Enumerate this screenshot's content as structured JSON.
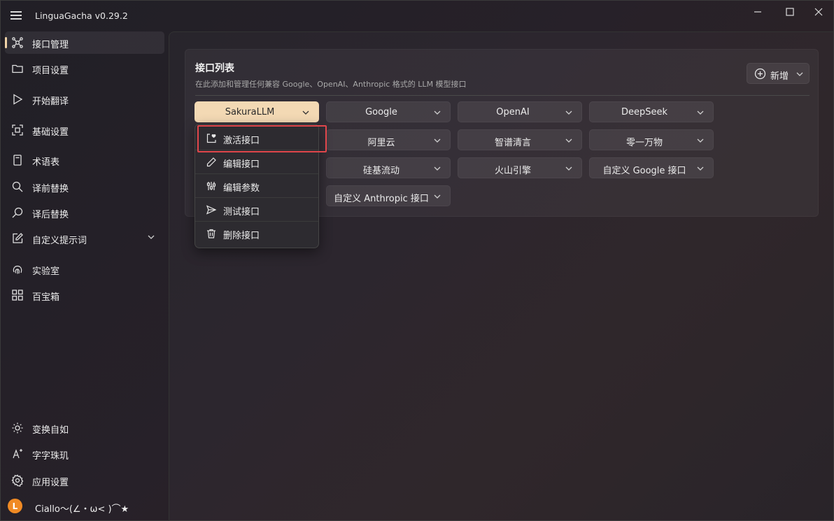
{
  "window": {
    "title": "LinguaGacha v0.29.2"
  },
  "sidebar": {
    "items": [
      {
        "label": "接口管理",
        "icon": "network-icon"
      },
      {
        "label": "项目设置",
        "icon": "folder-icon"
      },
      {
        "label": "开始翻译",
        "icon": "play-icon"
      },
      {
        "label": "基础设置",
        "icon": "settings-frame-icon"
      },
      {
        "label": "术语表",
        "icon": "book-icon"
      },
      {
        "label": "译前替换",
        "icon": "search-icon"
      },
      {
        "label": "译后替换",
        "icon": "search-alt-icon"
      },
      {
        "label": "自定义提示词",
        "icon": "edit-icon"
      },
      {
        "label": "实验室",
        "icon": "fingerprint-icon"
      },
      {
        "label": "百宝箱",
        "icon": "grid-icon"
      }
    ],
    "bottom": [
      {
        "label": "变换自如",
        "icon": "brightness-icon"
      },
      {
        "label": "字字珠玑",
        "icon": "sparkle-icon"
      },
      {
        "label": "应用设置",
        "icon": "gear-icon"
      }
    ],
    "user": {
      "initial": "L",
      "name": "Ciallo～(∠・ω< )⌒★"
    }
  },
  "card": {
    "title": "接口列表",
    "subtitle": "在此添加和管理任何兼容 Google、OpenAI、Anthropic 格式的 LLM 模型接口",
    "add_label": "新增"
  },
  "apis": [
    "SakuraLLM",
    "Google",
    "OpenAI",
    "DeepSeek",
    "阿里云",
    "智谱清言",
    "零一万物",
    "硅基流动",
    "火山引擎",
    "自定义 Google 接口",
    "自定义 Anthropic 接口"
  ],
  "menu": {
    "items": [
      {
        "label": "激活接口",
        "icon": "activate-icon"
      },
      {
        "label": "编辑接口",
        "icon": "pencil-icon"
      },
      {
        "label": "编辑参数",
        "icon": "sliders-icon"
      },
      {
        "label": "测试接口",
        "icon": "send-icon"
      },
      {
        "label": "删除接口",
        "icon": "trash-icon"
      }
    ]
  },
  "colors": {
    "accent": "#f3d9b4",
    "highlight": "#e0464b",
    "avatar": "#f08a24"
  }
}
